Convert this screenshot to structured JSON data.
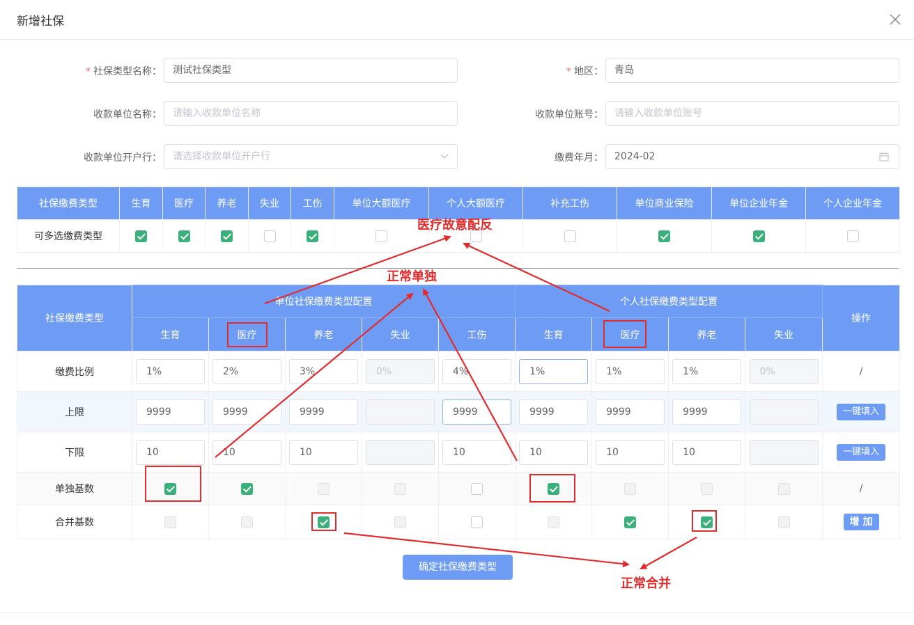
{
  "dialog": {
    "title": "新增社保"
  },
  "form": {
    "type_name": {
      "label": "社保类型名称",
      "required": "*",
      "value": "测试社保类型"
    },
    "region": {
      "label": "地区",
      "required": "*",
      "value": "青岛"
    },
    "payee_name": {
      "label": "收款单位名称",
      "placeholder": "请输入收款单位名称"
    },
    "payee_account": {
      "label": "收款单位账号",
      "placeholder": "请输入收款单位账号"
    },
    "payee_bank": {
      "label": "收款单位开户行",
      "placeholder": "请选择收款单位开户行"
    },
    "pay_month": {
      "label": "缴费年月",
      "value": "2024-02"
    }
  },
  "label_colon": "：",
  "type_table": {
    "header": [
      "社保缴费类型",
      "生育",
      "医疗",
      "养老",
      "失业",
      "工伤",
      "单位大额医疗",
      "个人大额医疗",
      "补充工伤",
      "单位商业保险",
      "单位企业年金",
      "个人企业年金"
    ],
    "row_label": "可多选缴费类型",
    "checked": [
      true,
      true,
      true,
      false,
      true,
      false,
      false,
      false,
      true,
      true,
      false
    ]
  },
  "config_table": {
    "corner_label": "社保缴费类型",
    "unit_group": "单位社保缴费类型配置",
    "personal_group": "个人社保缴费类型配置",
    "ops_label": "操作",
    "columns": [
      "生育",
      "医疗",
      "养老",
      "失业",
      "工伤",
      "生育",
      "医疗",
      "养老",
      "失业"
    ],
    "rows": {
      "ratio": {
        "label": "缴费比例",
        "values": [
          "1%",
          "2%",
          "3%",
          "0%",
          "4%",
          "1%",
          "1%",
          "1%",
          "0%"
        ],
        "op": "/"
      },
      "upper": {
        "label": "上限",
        "values": [
          "9999",
          "9999",
          "9999",
          "",
          "9999",
          "9999",
          "9999",
          "9999",
          ""
        ],
        "op": "一键填入"
      },
      "lower": {
        "label": "下限",
        "values": [
          "10",
          "10",
          "10",
          "",
          "10",
          "10",
          "10",
          "10",
          ""
        ],
        "op": "一键填入"
      },
      "single": {
        "label": "单独基数",
        "states": [
          "on",
          "on",
          "dis",
          "dis",
          "off",
          "on",
          "dis",
          "dis",
          "dis"
        ],
        "op": "/"
      },
      "merge": {
        "label": "合并基数",
        "states": [
          "dis",
          "dis",
          "on",
          "dis",
          "off",
          "dis",
          "on",
          "on",
          "dis"
        ],
        "op": "增 加"
      }
    }
  },
  "confirm_button": "确定社保缴费类型",
  "annotations": {
    "medical_mismatch": "医疗故意配反",
    "normal_single": "正常单独",
    "normal_merge": "正常合并"
  },
  "colors": {
    "accent": "#6e9cf5",
    "check": "#3cb07b",
    "annotation": "#e32b2b"
  }
}
